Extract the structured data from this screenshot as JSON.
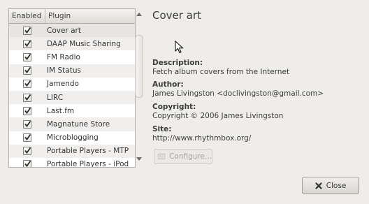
{
  "list": {
    "header_enabled": "Enabled",
    "header_plugin": "Plugin",
    "items": [
      {
        "name": "Cover art",
        "enabled": true
      },
      {
        "name": "DAAP Music Sharing",
        "enabled": true
      },
      {
        "name": "FM Radio",
        "enabled": true
      },
      {
        "name": "IM Status",
        "enabled": true
      },
      {
        "name": "Jamendo",
        "enabled": true
      },
      {
        "name": "LIRC",
        "enabled": true
      },
      {
        "name": "Last.fm",
        "enabled": true
      },
      {
        "name": "Magnatune Store",
        "enabled": true
      },
      {
        "name": "Microblogging",
        "enabled": true
      },
      {
        "name": "Portable Players - MTP",
        "enabled": true
      },
      {
        "name": "Portable Players - iPod",
        "enabled": true
      }
    ]
  },
  "detail": {
    "title": "Cover art",
    "description_label": "Description:",
    "description": "Fetch album covers from the Internet",
    "author_label": "Author:",
    "author": "James Livingston <doclivingston@gmail.com>",
    "copyright_label": "Copyright:",
    "copyright": "Copyright © 2006 James Livingston",
    "site_label": "Site:",
    "site": "http://www.rhythmbox.org/"
  },
  "buttons": {
    "configure_label": "Configure...",
    "close_label": "Close"
  },
  "colors": {
    "window_bg": "#efedea",
    "list_bg": "#ffffff",
    "row_alt": "#f1efed",
    "disabled_text": "#a7a39d"
  }
}
